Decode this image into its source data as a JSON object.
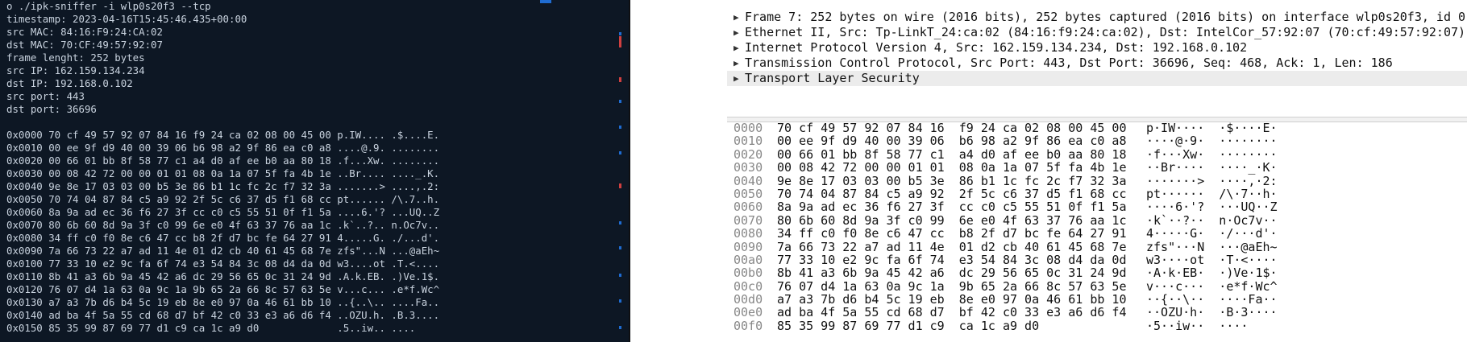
{
  "terminal": {
    "lines": [
      "o ./ipk-sniffer -i wlp0s20f3 --tcp",
      "timestamp: 2023-04-16T15:45:46.435+00:00",
      "src MAC: 84:16:F9:24:CA:02",
      "dst MAC: 70:CF:49:57:92:07",
      "frame lenght: 252 bytes",
      "src IP: 162.159.134.234",
      "dst IP: 192.168.0.102",
      "src port: 443",
      "dst port: 36696",
      "",
      "0x0000 70 cf 49 57 92 07 84 16 f9 24 ca 02 08 00 45 00 p.IW.... .$....E.",
      "0x0010 00 ee 9f d9 40 00 39 06 b6 98 a2 9f 86 ea c0 a8 ....@.9. ........",
      "0x0020 00 66 01 bb 8f 58 77 c1 a4 d0 af ee b0 aa 80 18 .f...Xw. ........",
      "0x0030 00 08 42 72 00 00 01 01 08 0a 1a 07 5f fa 4b 1e ..Br.... ...._.K.",
      "0x0040 9e 8e 17 03 03 00 b5 3e 86 b1 1c fc 2c f7 32 3a .......> ....,.2:",
      "0x0050 70 74 04 87 84 c5 a9 92 2f 5c c6 37 d5 f1 68 cc pt...... /\\.7..h.",
      "0x0060 8a 9a ad ec 36 f6 27 3f cc c0 c5 55 51 0f f1 5a ....6.'? ...UQ..Z",
      "0x0070 80 6b 60 8d 9a 3f c0 99 6e e0 4f 63 37 76 aa 1c .k`..?.. n.Oc7v..",
      "0x0080 34 ff c0 f0 8e c6 47 cc b8 2f d7 bc fe 64 27 91 4.....G. ./...d'.",
      "0x0090 7a 66 73 22 a7 ad 11 4e 01 d2 cb 40 61 45 68 7e zfs\"...N ...@aEh~",
      "0x0100 77 33 10 e2 9c fa 6f 74 e3 54 84 3c 08 d4 da 0d w3....ot .T.<....",
      "0x0110 8b 41 a3 6b 9a 45 42 a6 dc 29 56 65 0c 31 24 9d .A.k.EB. .)Ve.1$.",
      "0x0120 76 07 d4 1a 63 0a 9c 1a 9b 65 2a 66 8c 57 63 5e v...c... .e*f.Wc^",
      "0x0130 a7 a3 7b d6 b4 5c 19 eb 8e e0 97 0a 46 61 bb 10 ..{..\\.. ....Fa..",
      "0x0140 ad ba 4f 5a 55 cd 68 d7 bf 42 c0 33 e3 a6 d6 f4 ..OZU.h. .B.3....",
      "0x0150 85 35 99 87 69 77 d1 c9 ca 1c a9 d0             .5..iw.. ...."
    ]
  },
  "wireshark": {
    "tree": [
      "Frame 7: 252 bytes on wire (2016 bits), 252 bytes captured (2016 bits) on interface wlp0s20f3, id 0",
      "Ethernet II, Src: Tp-LinkT_24:ca:02 (84:16:f9:24:ca:02), Dst: IntelCor_57:92:07 (70:cf:49:57:92:07)",
      "Internet Protocol Version 4, Src: 162.159.134.234, Dst: 192.168.0.102",
      "Transmission Control Protocol, Src Port: 443, Dst Port: 36696, Seq: 468, Ack: 1, Len: 186",
      "Transport Layer Security"
    ],
    "hex": [
      {
        "off": "0000",
        "bytes": "70 cf 49 57 92 07 84 16  f9 24 ca 02 08 00 45 00",
        "ascii": "p·IW····  ·$····E·"
      },
      {
        "off": "0010",
        "bytes": "00 ee 9f d9 40 00 39 06  b6 98 a2 9f 86 ea c0 a8",
        "ascii": "····@·9·  ········"
      },
      {
        "off": "0020",
        "bytes": "00 66 01 bb 8f 58 77 c1  a4 d0 af ee b0 aa 80 18",
        "ascii": "·f···Xw·  ········"
      },
      {
        "off": "0030",
        "bytes": "00 08 42 72 00 00 01 01  08 0a 1a 07 5f fa 4b 1e",
        "ascii": "··Br····  ····_·K·"
      },
      {
        "off": "0040",
        "bytes": "9e 8e 17 03 03 00 b5 3e  86 b1 1c fc 2c f7 32 3a",
        "ascii": "·······>  ····,·2:"
      },
      {
        "off": "0050",
        "bytes": "70 74 04 87 84 c5 a9 92  2f 5c c6 37 d5 f1 68 cc",
        "ascii": "pt······  /\\·7··h·"
      },
      {
        "off": "0060",
        "bytes": "8a 9a ad ec 36 f6 27 3f  cc c0 c5 55 51 0f f1 5a",
        "ascii": "····6·'?  ···UQ··Z"
      },
      {
        "off": "0070",
        "bytes": "80 6b 60 8d 9a 3f c0 99  6e e0 4f 63 37 76 aa 1c",
        "ascii": "·k`··?··  n·Oc7v··"
      },
      {
        "off": "0080",
        "bytes": "34 ff c0 f0 8e c6 47 cc  b8 2f d7 bc fe 64 27 91",
        "ascii": "4·····G·  ·/···d'·"
      },
      {
        "off": "0090",
        "bytes": "7a 66 73 22 a7 ad 11 4e  01 d2 cb 40 61 45 68 7e",
        "ascii": "zfs\"···N  ···@aEh~"
      },
      {
        "off": "00a0",
        "bytes": "77 33 10 e2 9c fa 6f 74  e3 54 84 3c 08 d4 da 0d",
        "ascii": "w3····ot  ·T·<····"
      },
      {
        "off": "00b0",
        "bytes": "8b 41 a3 6b 9a 45 42 a6  dc 29 56 65 0c 31 24 9d",
        "ascii": "·A·k·EB·  ·)Ve·1$·"
      },
      {
        "off": "00c0",
        "bytes": "76 07 d4 1a 63 0a 9c 1a  9b 65 2a 66 8c 57 63 5e",
        "ascii": "v···c···  ·e*f·Wc^"
      },
      {
        "off": "00d0",
        "bytes": "a7 a3 7b d6 b4 5c 19 eb  8e e0 97 0a 46 61 bb 10",
        "ascii": "··{··\\··  ····Fa··"
      },
      {
        "off": "00e0",
        "bytes": "ad ba 4f 5a 55 cd 68 d7  bf 42 c0 33 e3 a6 d6 f4",
        "ascii": "··OZU·h·  ·B·3····"
      },
      {
        "off": "00f0",
        "bytes": "85 35 99 87 69 77 d1 c9  ca 1c a9 d0",
        "ascii": "·5··iw··  ····"
      }
    ]
  },
  "colors": {
    "terminal_bg": "#0d1724",
    "terminal_fg": "#c9d3df",
    "accent_blue": "#1f6cd1",
    "accent_red": "#d04040"
  }
}
